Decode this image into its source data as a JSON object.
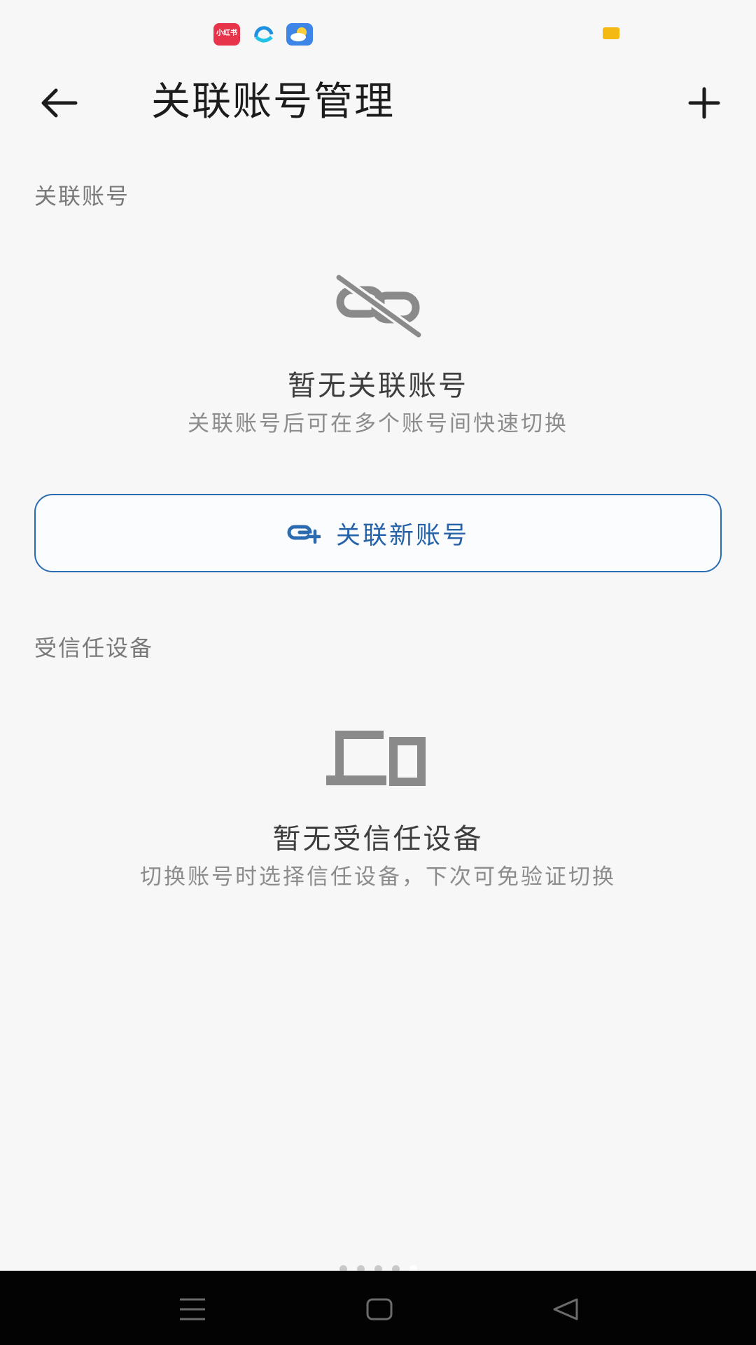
{
  "status_bar": {
    "notification_icons": [
      "xiaohongshu-app-icon",
      "browser-app-icon",
      "weather-app-icon"
    ],
    "xiaohongshu_label": "小红书",
    "battery_color": "#f5b914"
  },
  "header": {
    "title": "关联账号管理",
    "back_icon": "arrow-left-icon",
    "add_icon": "plus-icon"
  },
  "linked_accounts": {
    "section_label": "关联账号",
    "empty_icon": "unlink-icon",
    "empty_title": "暂无关联账号",
    "empty_desc": "关联账号后可在多个账号间快速切换",
    "button_icon": "link-add-icon",
    "button_label": "关联新账号"
  },
  "trusted_devices": {
    "section_label": "受信任设备",
    "empty_icon": "devices-icon",
    "empty_title": "暂无受信任设备",
    "empty_desc": "切换账号时选择信任设备，下次可免验证切换"
  },
  "page_indicator": {
    "pages": 5,
    "active_index": 4
  },
  "nav_bar": {
    "buttons": [
      "menu-icon",
      "home-icon",
      "back-triangle-icon"
    ]
  },
  "colors": {
    "accent": "#2b6cb0",
    "background": "#f7f7f8",
    "icon_gray": "#8a8a8a"
  }
}
